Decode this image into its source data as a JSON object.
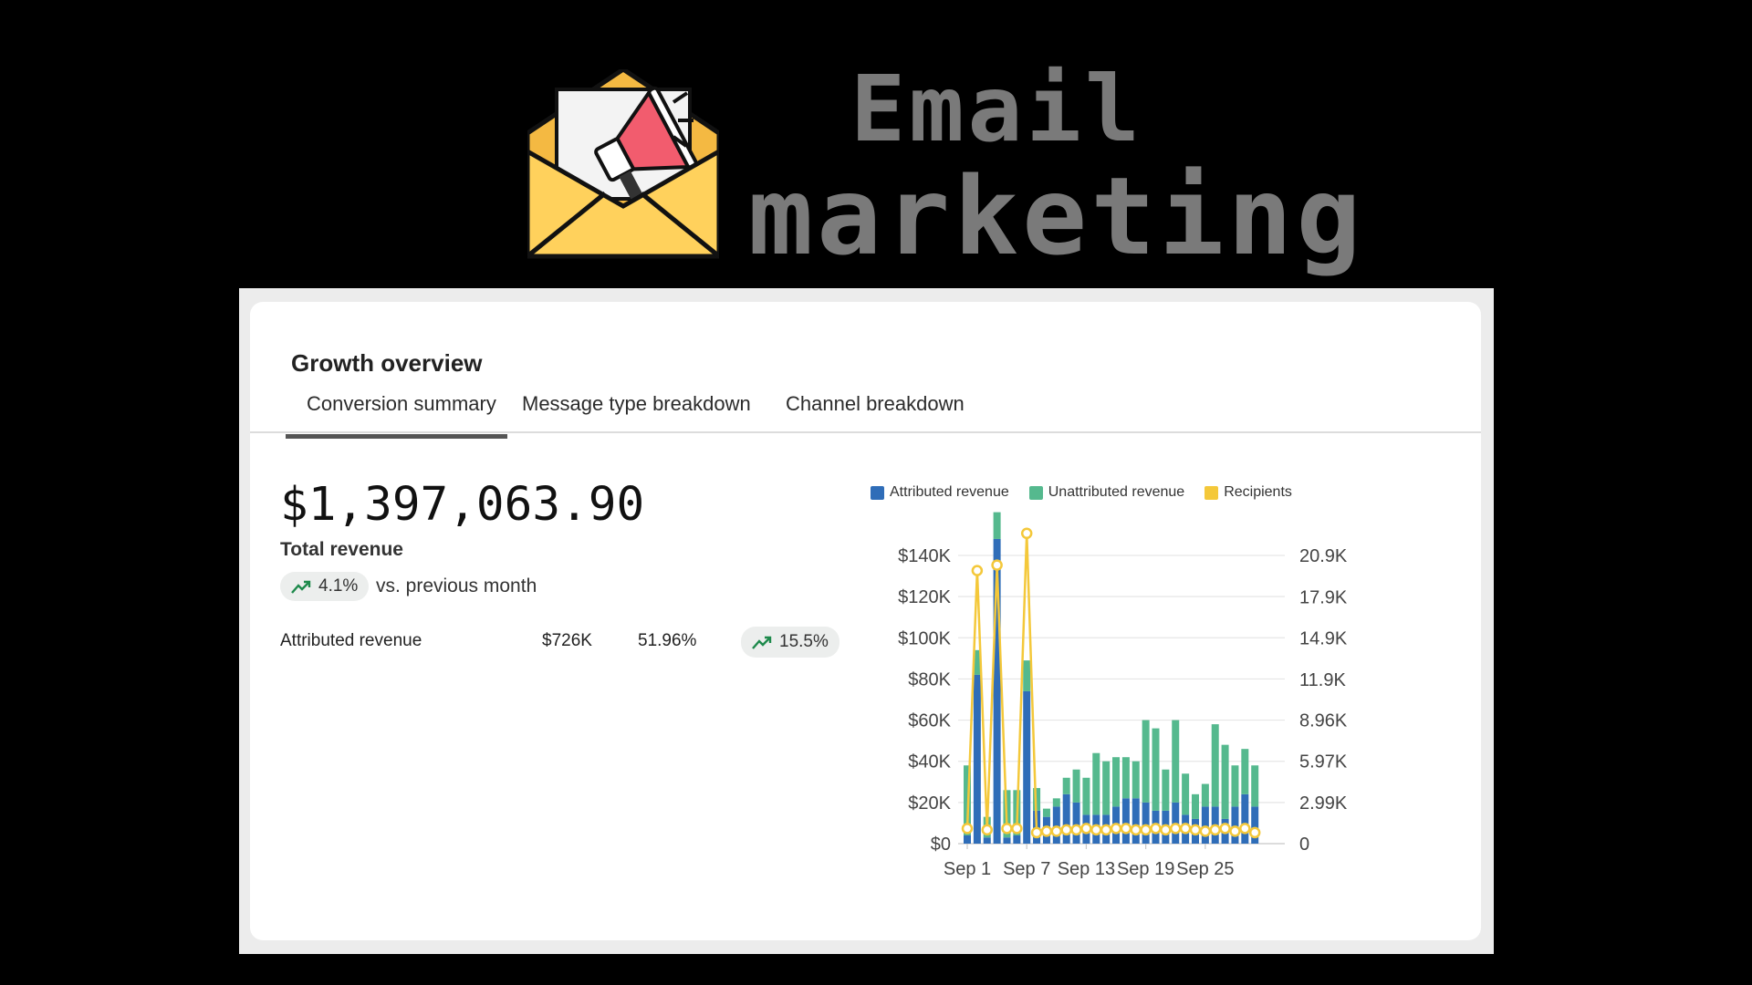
{
  "banner": {
    "title_line1": "Email",
    "title_line2": "marketing",
    "icon": "envelope-megaphone-icon",
    "colors": {
      "envelope": "#FFD15C",
      "envelope_dark": "#F4B942",
      "megaphone": "#F25C6E"
    }
  },
  "card": {
    "title": "Growth overview",
    "tabs": [
      {
        "label": "Conversion summary",
        "active": true
      },
      {
        "label": "Message type breakdown",
        "active": false
      },
      {
        "label": "Channel breakdown",
        "active": false
      }
    ],
    "total_revenue": "$1,397,063.90",
    "total_label": "Total revenue",
    "change": {
      "icon": "trend-up-icon",
      "value": "4.1%",
      "suffix": "vs. previous month"
    },
    "rows": [
      {
        "label": "Attributed revenue",
        "amount": "$726K",
        "share": "51.96%",
        "change": "15.5%"
      }
    ]
  },
  "chart_data": {
    "type": "bar",
    "stacked": true,
    "legend_position": "top",
    "grid": true,
    "x": [
      "Sep 1",
      "Sep 2",
      "Sep 3",
      "Sep 4",
      "Sep 5",
      "Sep 6",
      "Sep 7",
      "Sep 8",
      "Sep 9",
      "Sep 10",
      "Sep 11",
      "Sep 12",
      "Sep 13",
      "Sep 14",
      "Sep 15",
      "Sep 16",
      "Sep 17",
      "Sep 18",
      "Sep 19",
      "Sep 20",
      "Sep 21",
      "Sep 22",
      "Sep 23",
      "Sep 24",
      "Sep 25",
      "Sep 26",
      "Sep 27",
      "Sep 28",
      "Sep 29",
      "Sep 30"
    ],
    "x_tick_labels": [
      "Sep 1",
      "Sep 7",
      "Sep 13",
      "Sep 19",
      "Sep 25"
    ],
    "x_tick_indices": [
      0,
      6,
      12,
      18,
      24
    ],
    "series": [
      {
        "name": "Attributed revenue",
        "axis": "left",
        "color": "#2F6DB8",
        "values": [
          4000,
          82000,
          3000,
          148000,
          3000,
          4000,
          74000,
          16000,
          13000,
          18000,
          24000,
          20000,
          14000,
          14000,
          14000,
          18000,
          22000,
          22000,
          20000,
          16000,
          16000,
          20000,
          14000,
          12000,
          18000,
          18000,
          12000,
          18000,
          24000,
          18000
        ]
      },
      {
        "name": "Unattributed revenue",
        "axis": "left",
        "color": "#55B98E",
        "values": [
          34000,
          12000,
          10000,
          13000,
          23000,
          22000,
          15000,
          11000,
          4000,
          4000,
          8000,
          16000,
          18000,
          30000,
          26000,
          24000,
          20000,
          18000,
          40000,
          40000,
          20000,
          40000,
          20000,
          12000,
          11000,
          40000,
          36000,
          20000,
          22000,
          20000
        ]
      },
      {
        "name": "Recipients",
        "type": "line",
        "axis": "right",
        "color": "#F4C83A",
        "values": [
          1100,
          19800,
          1000,
          20200,
          1100,
          1100,
          22500,
          800,
          900,
          900,
          1000,
          1000,
          1100,
          1000,
          1000,
          1100,
          1100,
          1000,
          1000,
          1100,
          1000,
          1100,
          1100,
          1000,
          900,
          1000,
          1100,
          900,
          1100,
          800
        ]
      }
    ],
    "y_left": {
      "min": 0,
      "max": 140000,
      "ticks": [
        0,
        20000,
        40000,
        60000,
        80000,
        100000,
        120000,
        140000
      ],
      "tick_labels": [
        "$0",
        "$20K",
        "$40K",
        "$60K",
        "$80K",
        "$100K",
        "$120K",
        "$140K"
      ]
    },
    "y_right": {
      "min": 0,
      "max": 20900,
      "ticks": [
        0,
        2990,
        5970,
        8960,
        11900,
        14900,
        17900,
        20900
      ],
      "tick_labels": [
        "0",
        "2.99K",
        "5.97K",
        "8.96K",
        "11.9K",
        "14.9K",
        "17.9K",
        "20.9K"
      ]
    }
  }
}
